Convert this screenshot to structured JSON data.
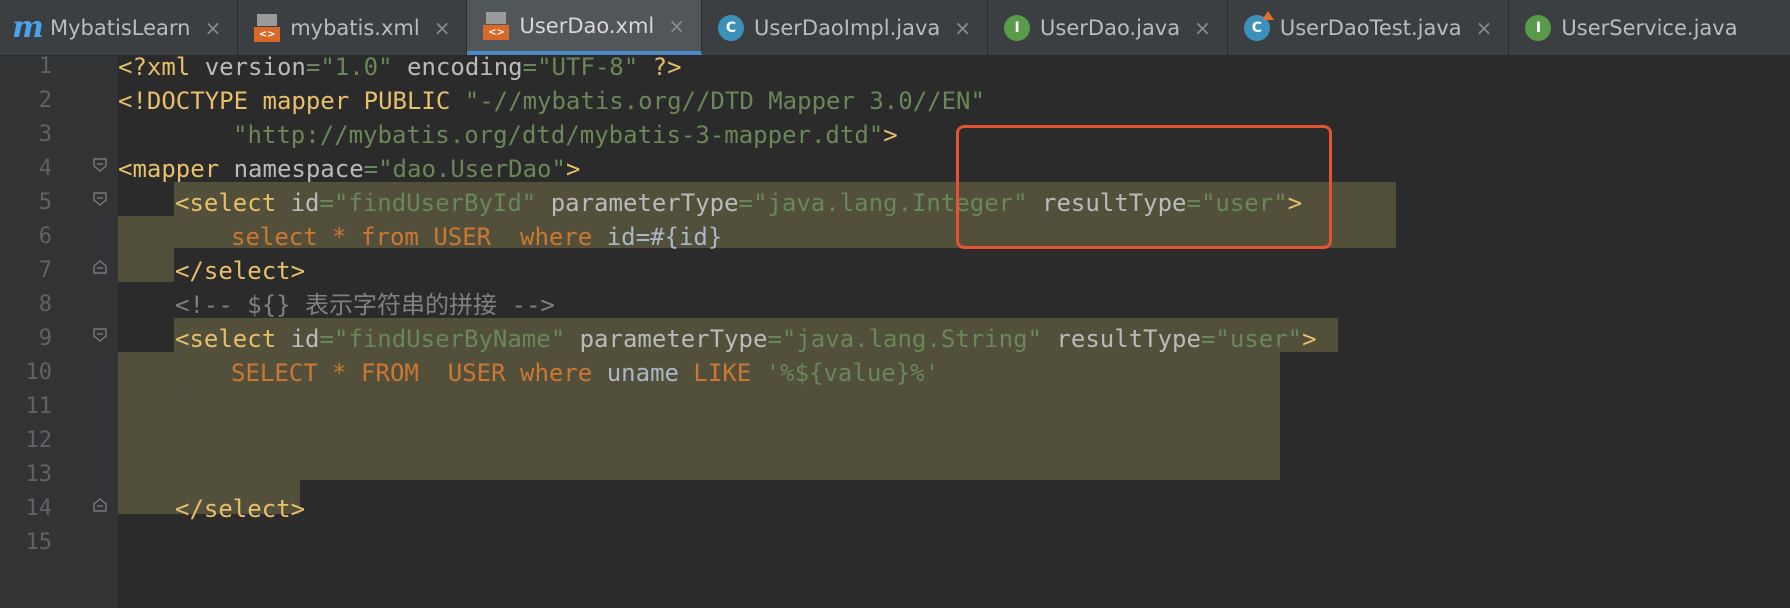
{
  "tabs": [
    {
      "label": "MybatisLearn",
      "icon": "mybatis-m-icon",
      "active": false
    },
    {
      "label": "mybatis.xml",
      "icon": "xml-file-icon",
      "active": false
    },
    {
      "label": "UserDao.xml",
      "icon": "xml-file-icon",
      "active": true
    },
    {
      "label": "UserDaoImpl.java",
      "icon": "class-icon",
      "active": false
    },
    {
      "label": "UserDao.java",
      "icon": "interface-icon",
      "active": false
    },
    {
      "label": "UserDaoTest.java",
      "icon": "test-class-icon",
      "active": false
    },
    {
      "label": "UserService.java",
      "icon": "interface-icon",
      "active": false
    }
  ],
  "close_glyph": "×",
  "line_numbers": [
    "1",
    "2",
    "3",
    "4",
    "5",
    "6",
    "7",
    "8",
    "9",
    "10",
    "11",
    "12",
    "13",
    "14",
    "15"
  ],
  "code": {
    "l1": {
      "a": "<?xml ",
      "b": "version",
      "c": "=",
      "d": "\"1.0\"",
      "e": " ",
      "f": "encoding",
      "g": "=",
      "h": "\"UTF-8\"",
      "i": " ?>"
    },
    "l2": {
      "a": "<!DOCTYPE mapper PUBLIC ",
      "b": "\"-//mybatis.org//DTD Mapper 3.0//EN\""
    },
    "l3": {
      "a": "\"http://mybatis.org/dtd/mybatis-3-mapper.dtd\"",
      "b": ">"
    },
    "l4": {
      "a": "<mapper ",
      "b": "namespace",
      "c": "=",
      "d": "\"dao.UserDao\"",
      "e": ">"
    },
    "l5": {
      "a": "<select ",
      "b": "id",
      "c": "=",
      "d": "\"findUserById\"",
      "e": " parameterType",
      "f": "=",
      "g": "\"java.lang.Integer\"",
      "h": " resultType",
      "i": "=",
      "j": "\"user\"",
      "k": ">"
    },
    "l6": {
      "a": "select ",
      "b": "*",
      "c": " from ",
      "d": "USER",
      "e": "  where ",
      "f": "id=#{id}"
    },
    "l7": {
      "a": "</select>"
    },
    "l8": {
      "a": "<!-- ${} 表示字符串的拼接 -->"
    },
    "l9": {
      "a": "<select ",
      "b": "id",
      "c": "=",
      "d": "\"findUserByName\"",
      "e": " parameterType",
      "f": "=",
      "g": "\"java.lang.String\"",
      "h": " resultType",
      "i": "=",
      "j": "\"user\"",
      "k": ">"
    },
    "l10": {
      "a": "SELECT ",
      "b": "*",
      "c": " FROM  ",
      "d": "USER",
      "e": " where ",
      "f": "uname ",
      "g": "LIKE ",
      "h": "'%${value}%'"
    },
    "l14": {
      "a": "</select>"
    }
  },
  "colors": {
    "tag": "#e8bf6a",
    "attribute": "#bababa",
    "string": "#6a8759",
    "keyword": "#cc7832",
    "comment": "#808080",
    "highlight": "#52503a",
    "annotation_box": "#e2542f"
  }
}
